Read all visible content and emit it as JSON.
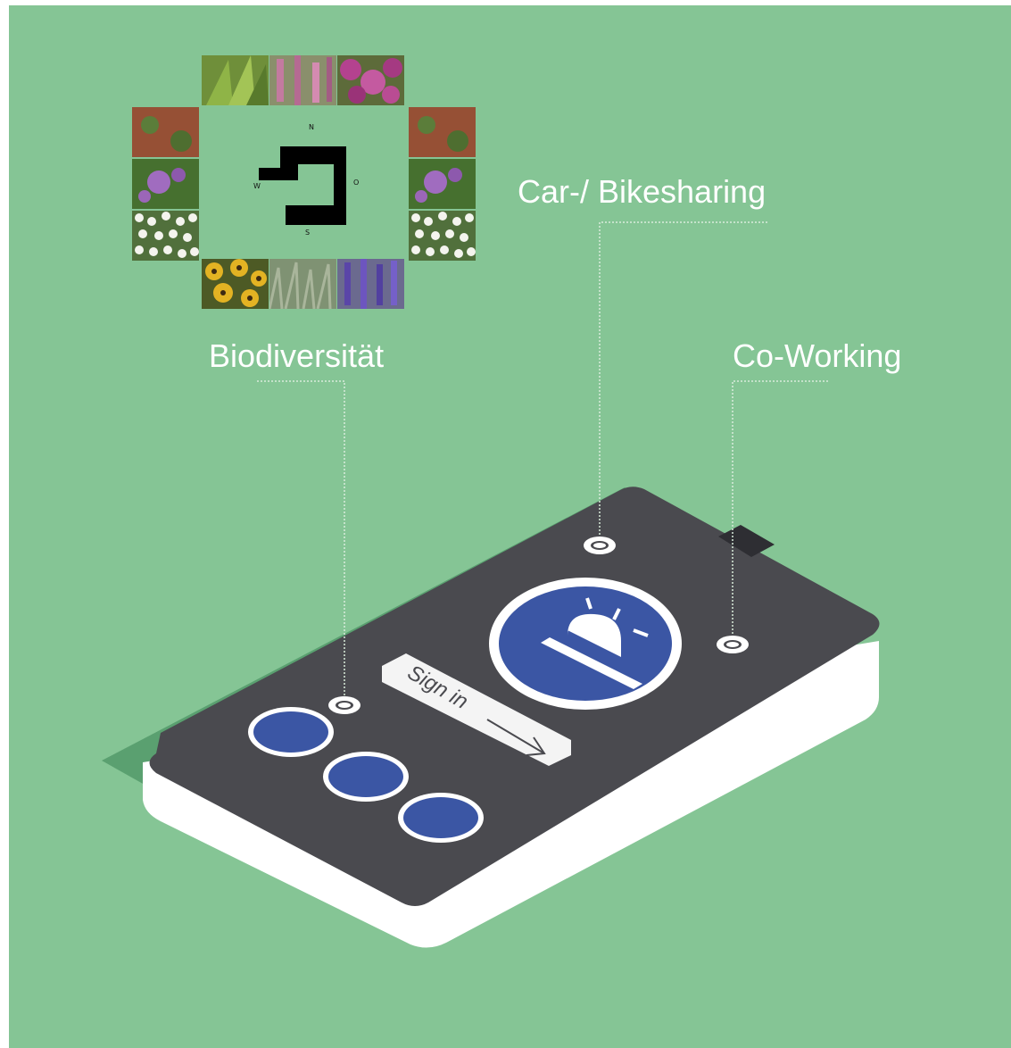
{
  "callouts": {
    "biodiversity": "Biodiversität",
    "sharing": "Car-/ Bikesharing",
    "coworking": "Co-Working"
  },
  "compass": {
    "north": "N",
    "east": "O",
    "south": "S",
    "west": "W"
  },
  "phone": {
    "sign_in_label": "Sign in",
    "alarm_icon": "siren-icon",
    "action_buttons": 3
  },
  "colors": {
    "background": "#85c595",
    "screen": "#4a4a4f",
    "accent_blue": "#3b56a4",
    "phone_body": "#ffffff",
    "shadow": "#5aa070"
  },
  "plants": {
    "top": [
      "fern",
      "foxglove",
      "pink-flowers"
    ],
    "left": [
      "red-groundcover",
      "purple-flowers",
      "white-flowers"
    ],
    "right": [
      "red-groundcover",
      "purple-flowers",
      "white-flowers"
    ],
    "bottom": [
      "yellow-coneflower",
      "grass",
      "purple-sage"
    ]
  }
}
